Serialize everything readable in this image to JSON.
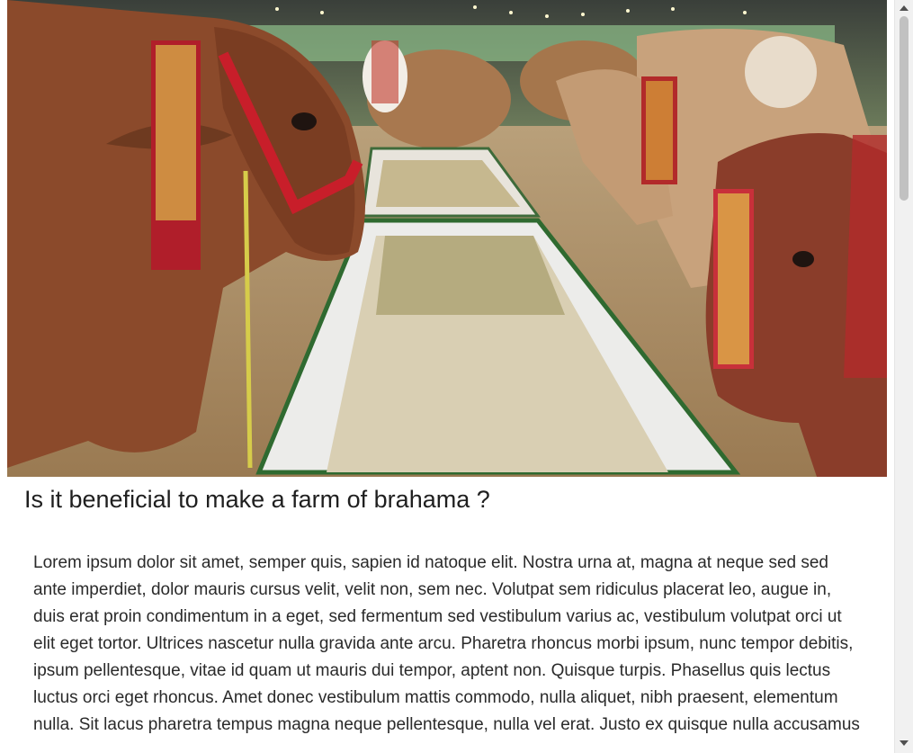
{
  "article": {
    "image_alt": "Decorated Brahman cattle eating from feeding troughs",
    "title": "Is it beneficial to make a farm of brahama ?",
    "body": "Lorem ipsum dolor sit amet, semper quis, sapien id natoque elit. Nostra urna at, magna at neque sed sed ante imperdiet, dolor mauris cursus velit, velit non, sem nec. Volutpat sem ridiculus placerat leo, augue in, duis erat proin condimentum in a eget, sed fermentum sed vestibulum varius ac, vestibulum volutpat orci ut elit eget tortor. Ultrices nascetur nulla gravida ante arcu. Pharetra rhoncus morbi ipsum, nunc tempor debitis, ipsum pellentesque, vitae id quam ut mauris dui tempor, aptent non. Quisque turpis. Phasellus quis lectus luctus orci eget rhoncus. Amet donec vestibulum mattis commodo, nulla aliquet, nibh praesent, elementum nulla. Sit lacus pharetra tempus magna neque pellentesque, nulla vel erat. Justo ex quisque nulla accusamus"
  },
  "colors": {
    "title": "#1f1f1f",
    "body_text": "#2a2a2a",
    "scrollbar_thumb": "#c1c1c1"
  },
  "icons": {
    "scroll_up": "triangle-up",
    "scroll_down": "triangle-down"
  }
}
